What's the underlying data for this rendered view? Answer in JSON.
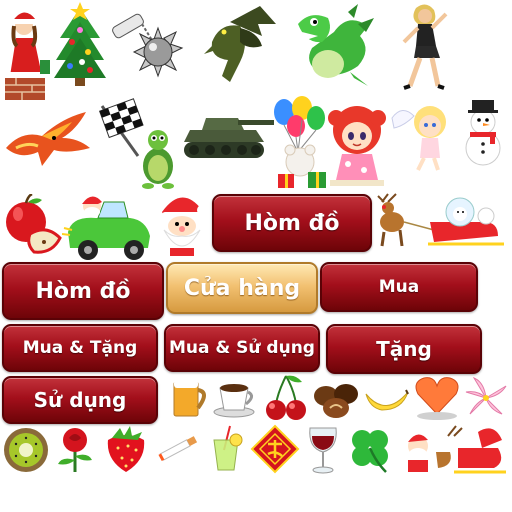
{
  "buttons": {
    "hom_do_top": "Hòm đồ",
    "hom_do": "Hòm đồ",
    "cua_hang": "Cửa hàng",
    "mua": "Mua",
    "mua_tang": "Mua & Tặng",
    "mua_su_dung": "Mua & Sử dụng",
    "tang": "Tặng",
    "su_dung": "Sử dụng"
  },
  "colors": {
    "button_red": "#a30f1b",
    "button_gold": "#f2c172"
  },
  "icons": [
    "santa-girl-chimney-icon",
    "christmas-tree-icon",
    "mace-weapon-icon",
    "dragon-green-dark-icon",
    "dragon-green-icon",
    "dancing-girl-icon",
    "phoenix-icon",
    "checkered-flag-icon",
    "turtle-icon",
    "tank-icon",
    "balloons-teddy-icon",
    "red-hair-girl-icon",
    "angel-girl-icon",
    "snowman-icon",
    "apple-icon",
    "santa-car-icon",
    "santa-face-icon",
    "reindeer-sleigh-icon",
    "beer-icon",
    "coffee-cup-icon",
    "cherries-icon",
    "chocolates-icon",
    "banana-icon",
    "heart-cake-icon",
    "lily-flower-icon",
    "kiwi-icon",
    "rose-icon",
    "strawberry-icon",
    "cigarette-icon",
    "lemonade-icon",
    "tet-diamond-icon",
    "wine-glass-icon",
    "four-leaf-clover-icon",
    "santa-sleigh-icon"
  ]
}
